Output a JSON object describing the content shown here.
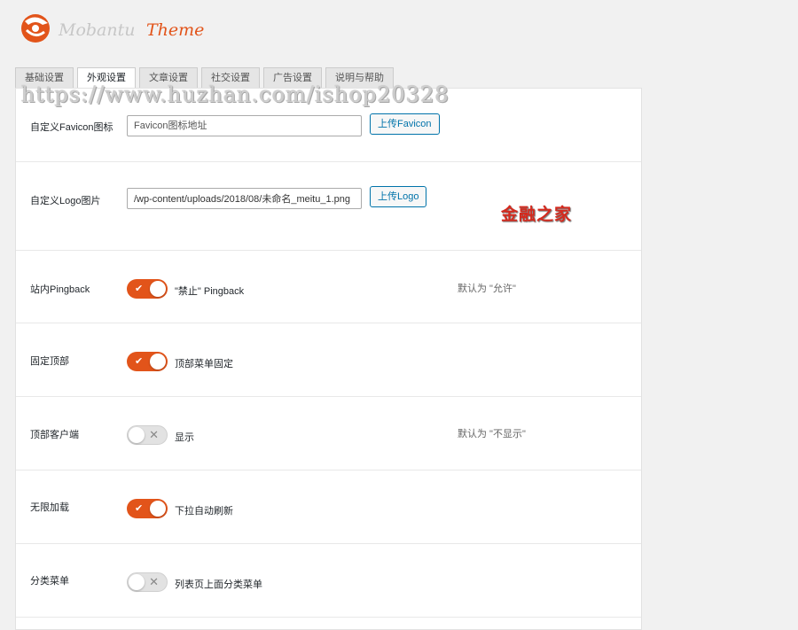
{
  "brand": {
    "logo_text": "Mobantu Theme",
    "accent": "#e2541a"
  },
  "tabs": [
    {
      "label": "基础设置"
    },
    {
      "label": "外观设置",
      "active": true
    },
    {
      "label": "文章设置"
    },
    {
      "label": "社交设置"
    },
    {
      "label": "广告设置"
    },
    {
      "label": "说明与帮助"
    }
  ],
  "settings": {
    "favicon": {
      "label": "自定义Favicon图标",
      "placeholder": "Favicon图标地址",
      "value": "",
      "button": "上传Favicon"
    },
    "logo": {
      "label": "自定义Logo图片",
      "value": "/wp-content/uploads/2018/08/未命名_meitu_1.png",
      "button": "上传Logo"
    },
    "pingback": {
      "label": "站内Pingback",
      "state": "on",
      "text": "\"禁止\" Pingback",
      "note": "默认为 \"允许\""
    },
    "fixed_top": {
      "label": "固定顶部",
      "state": "on",
      "text": "顶部菜单固定"
    },
    "top_client": {
      "label": "顶部客户端",
      "state": "off",
      "text": "显示",
      "note": "默认为 \"不显示\""
    },
    "infinite_load": {
      "label": "无限加载",
      "state": "on",
      "text": "下拉自动刷新"
    },
    "category_menu": {
      "label": "分类菜单",
      "state": "off",
      "text": "列表页上面分类菜单"
    }
  },
  "icons": {
    "on": "check-icon",
    "off": "x-icon"
  },
  "overlays": {
    "watermark": "https://www.huzhan.com/ishop20328",
    "stamp": "金融之家"
  }
}
